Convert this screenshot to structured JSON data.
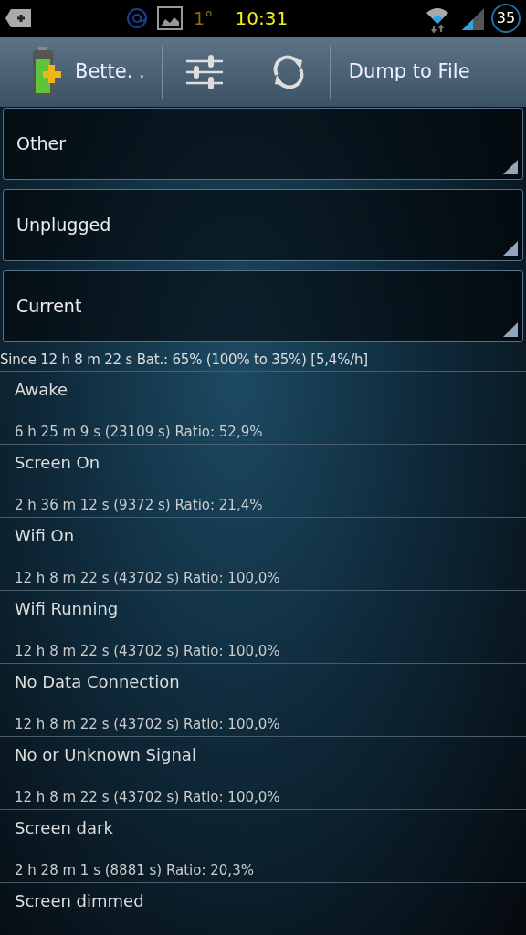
{
  "status_bar": {
    "degree": "1°",
    "time": "10:31",
    "battery": "35"
  },
  "toolbar": {
    "app_button": "Bette. .",
    "dump_button": "Dump to File"
  },
  "spinners": [
    {
      "value": "Other"
    },
    {
      "value": "Unplugged"
    },
    {
      "value": "Current"
    }
  ],
  "summary": "Since 12 h 8 m 22 s  Bat.: 65% (100% to 35%) [5,4%/h]",
  "rows": [
    {
      "title": "Awake",
      "detail": "6 h 25 m 9 s  (23109 s) Ratio: 52,9%"
    },
    {
      "title": "Screen On",
      "detail": "2 h 36 m 12 s  (9372 s) Ratio: 21,4%"
    },
    {
      "title": "Wifi On",
      "detail": "12 h 8 m 22 s  (43702 s) Ratio: 100,0%"
    },
    {
      "title": "Wifi Running",
      "detail": "12 h 8 m 22 s  (43702 s) Ratio: 100,0%"
    },
    {
      "title": "No Data Connection",
      "detail": "12 h 8 m 22 s  (43702 s) Ratio: 100,0%"
    },
    {
      "title": "No or Unknown Signal",
      "detail": "12 h 8 m 22 s  (43702 s) Ratio: 100,0%"
    },
    {
      "title": "Screen dark",
      "detail": "2 h 28 m 1 s  (8881 s) Ratio: 20,3%"
    },
    {
      "title": "Screen dimmed"
    }
  ]
}
